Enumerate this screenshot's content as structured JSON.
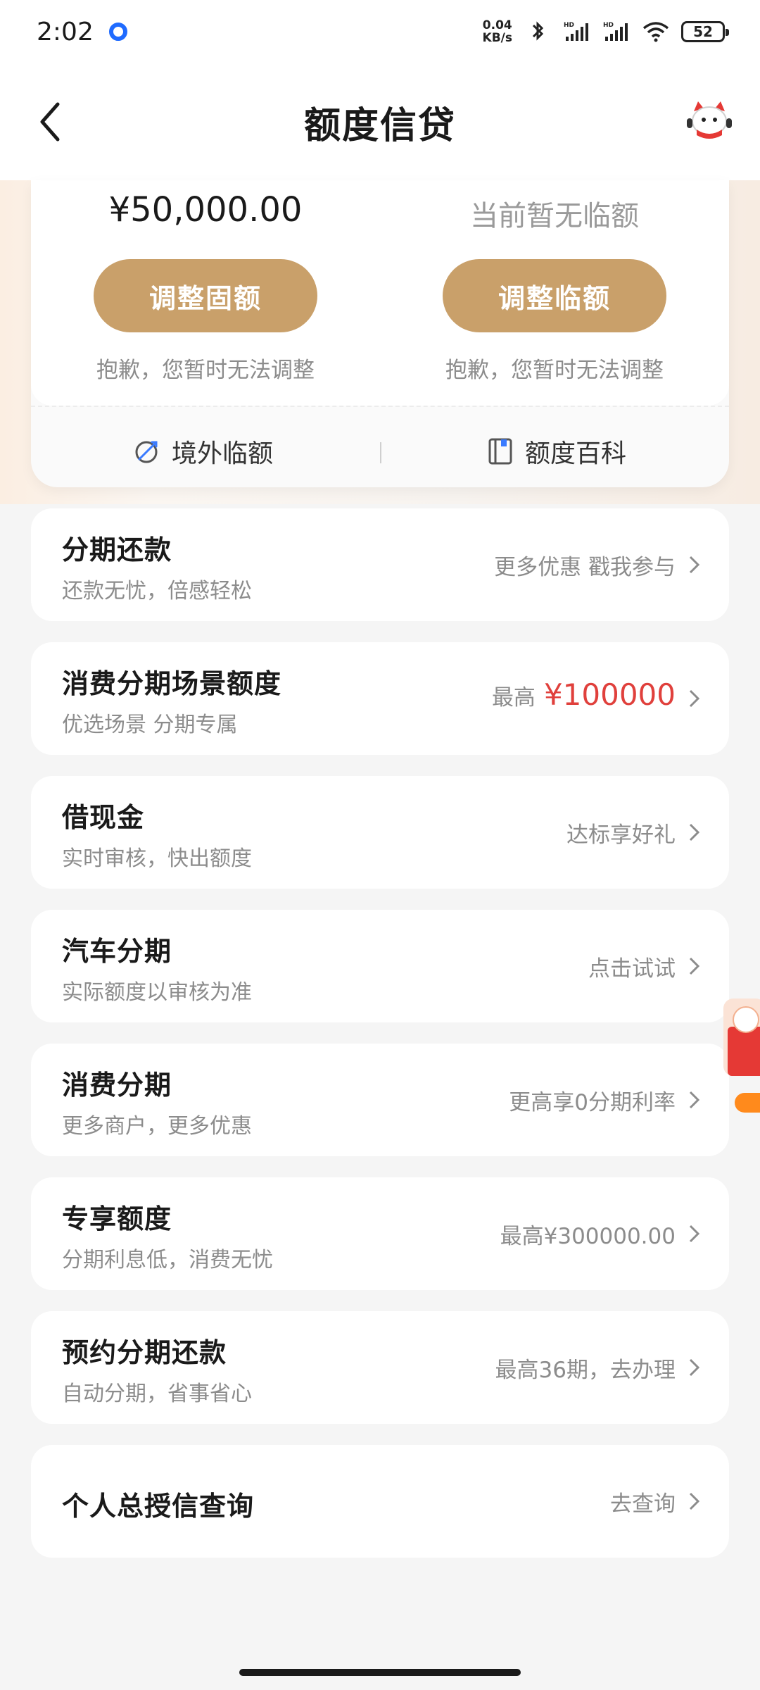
{
  "status_bar": {
    "time": "2:02",
    "net_speed_value": "0.04",
    "net_speed_unit": "KB/s",
    "battery": "52"
  },
  "header": {
    "title": "额度信贷"
  },
  "limit_card": {
    "fixed_amount": "¥50,000.00",
    "temp_amount": "当前暂无临额",
    "adjust_fixed_label": "调整固额",
    "adjust_temp_label": "调整临额",
    "adjust_fixed_note": "抱歉，您暂时无法调整",
    "adjust_temp_note": "抱歉，您暂时无法调整",
    "overseas_label": "境外临额",
    "encyclopedia_label": "额度百科"
  },
  "items": [
    {
      "title": "分期还款",
      "subtitle": "还款无忧，倍感轻松",
      "right": "更多优惠  戳我参与"
    },
    {
      "title": "消费分期场景额度",
      "subtitle": "优选场景 分期专属",
      "right": "最高",
      "right_highlight": "¥100000"
    },
    {
      "title": "借现金",
      "subtitle": "实时审核，快出额度",
      "right": "达标享好礼"
    },
    {
      "title": "汽车分期",
      "subtitle": "实际额度以审核为准",
      "right": "点击试试"
    },
    {
      "title": "消费分期",
      "subtitle": "更多商户，更多优惠",
      "right": "更高享0分期利率"
    },
    {
      "title": "专享额度",
      "subtitle": "分期利息低，消费无忧",
      "right": "最高¥300000.00"
    },
    {
      "title": "预约分期还款",
      "subtitle": "自动分期，省事省心",
      "right": "最高36期，去办理"
    },
    {
      "title": "个人总授信查询",
      "right": "去查询"
    }
  ],
  "colors": {
    "accent_gold": "#c9a06a",
    "highlight_red": "#e0403c",
    "page_bg": "#f5f5f5"
  }
}
